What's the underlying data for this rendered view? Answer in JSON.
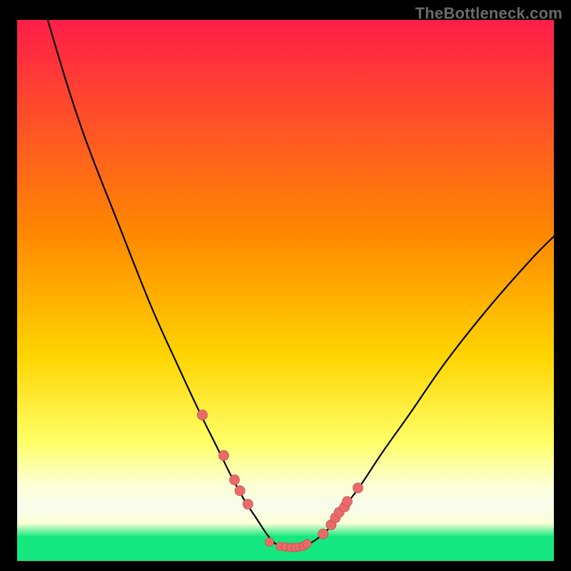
{
  "watermark": "TheBottleneck.com",
  "colors": {
    "curve": "#000000",
    "dots": "#ea6a6a",
    "dot_stroke": "#c94f4f",
    "page_bg": "#000000",
    "grad_top": "#ff1e4a",
    "grad_mid_high": "#ff8a00",
    "grad_mid": "#ffd400",
    "grad_mid_low": "#ffff66",
    "grad_band_pale": "#fdffd6",
    "grad_band_cream": "#f7fceb",
    "grad_bottom": "#15e880"
  },
  "chart_data": {
    "type": "line",
    "title": "",
    "xlabel": "",
    "ylabel": "",
    "xlim": [
      0,
      100
    ],
    "ylim": [
      0,
      100
    ],
    "series": [
      {
        "name": "bottleneck-curve",
        "x": [
          0,
          6,
          12,
          19,
          25,
          30,
          34,
          37,
          40,
          42.5,
          44.5,
          46.5,
          48,
          49.5,
          51,
          53,
          55,
          57,
          59,
          61,
          64,
          68,
          73,
          80,
          88,
          96,
          100
        ],
        "y": [
          120,
          99,
          80,
          62,
          47,
          36,
          27.5,
          21.5,
          15.5,
          11,
          8,
          5,
          3.3,
          2.7,
          2.5,
          2.7,
          3.5,
          5,
          7,
          10,
          14,
          20,
          27,
          37,
          47,
          56,
          60
        ]
      }
    ],
    "points": {
      "name": "highlight-dots",
      "x": [
        34.5,
        38.5,
        40.5,
        41.5,
        43.0,
        47.0,
        49.0,
        50.0,
        51.0,
        51.8,
        52.5,
        53.3,
        54.0,
        57.0,
        58.5,
        59.3,
        60.0,
        61.0,
        61.5,
        63.5
      ],
      "y": [
        27.0,
        19.5,
        15.0,
        13.0,
        10.5,
        3.5,
        2.7,
        2.6,
        2.5,
        2.5,
        2.6,
        2.7,
        3.2,
        5.0,
        6.7,
        8.0,
        9.0,
        10.0,
        11.0,
        13.5
      ],
      "r_base": 7,
      "r_cluster": 6
    },
    "background_gradient_stops": [
      {
        "offset": 0.0,
        "key": "grad_top"
      },
      {
        "offset": 0.4,
        "key": "grad_mid_high"
      },
      {
        "offset": 0.62,
        "key": "grad_mid"
      },
      {
        "offset": 0.78,
        "key": "grad_mid_low"
      },
      {
        "offset": 0.86,
        "key": "grad_band_pale"
      },
      {
        "offset": 0.9,
        "key": "grad_band_cream"
      },
      {
        "offset": 0.93,
        "key": "grad_band_pale"
      },
      {
        "offset": 0.955,
        "key": "grad_bottom"
      },
      {
        "offset": 1.0,
        "key": "grad_bottom"
      }
    ]
  }
}
